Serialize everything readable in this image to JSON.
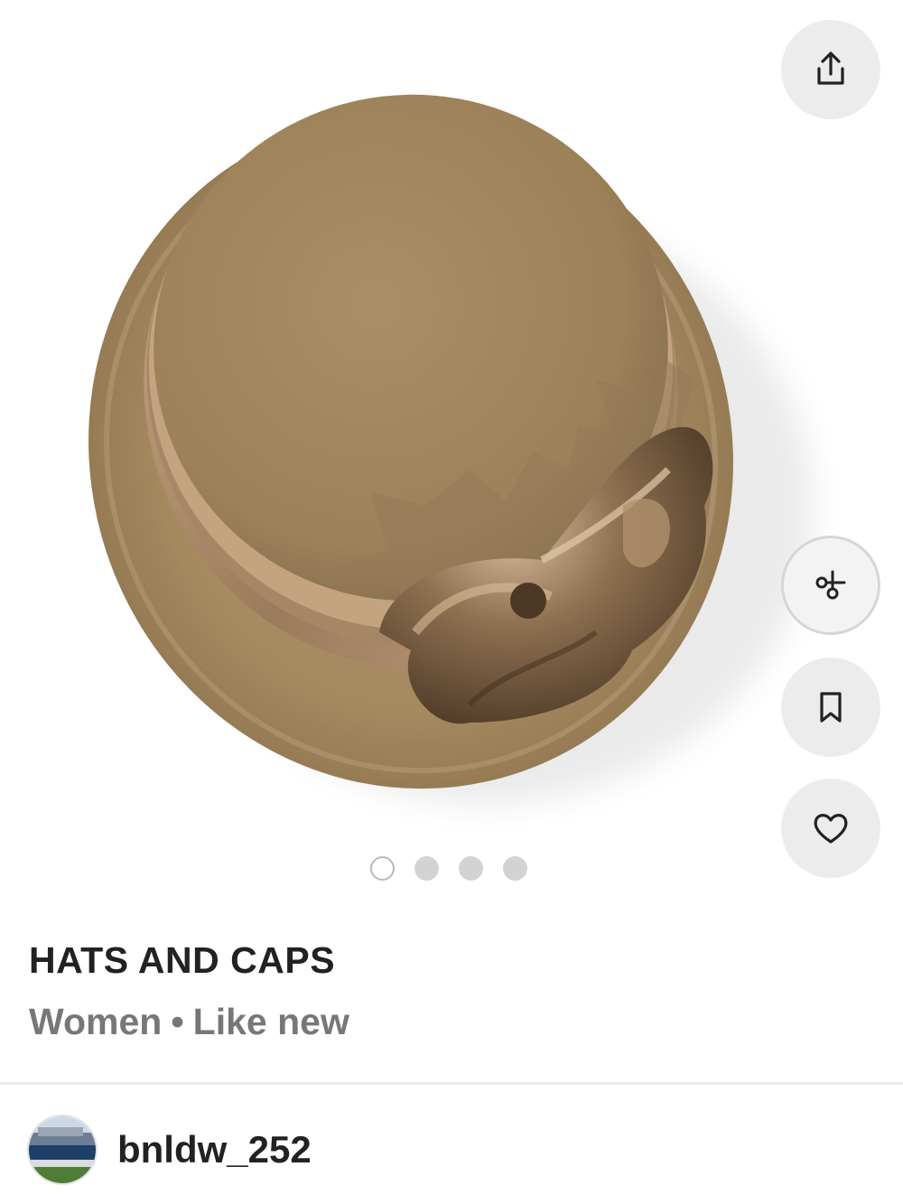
{
  "listing": {
    "title": "HATS AND CAPS",
    "category": "Women",
    "separator": "•",
    "condition": "Like new"
  },
  "carousel": {
    "image_count": 4,
    "active_index": 0,
    "image_description_icon": "hat-photo"
  },
  "actions": {
    "share_icon": "share-icon",
    "scissors_icon": "scissors-icon",
    "bookmark_icon": "bookmark-icon",
    "heart_icon": "heart-icon"
  },
  "seller": {
    "username": "bnldw_252",
    "avatar_icon": "avatar-photo"
  },
  "colors": {
    "felt": "#a48a62",
    "satin": "#8d7253",
    "button_bg": "#ececec",
    "title_text": "#222222",
    "subtitle_text": "#777777"
  }
}
